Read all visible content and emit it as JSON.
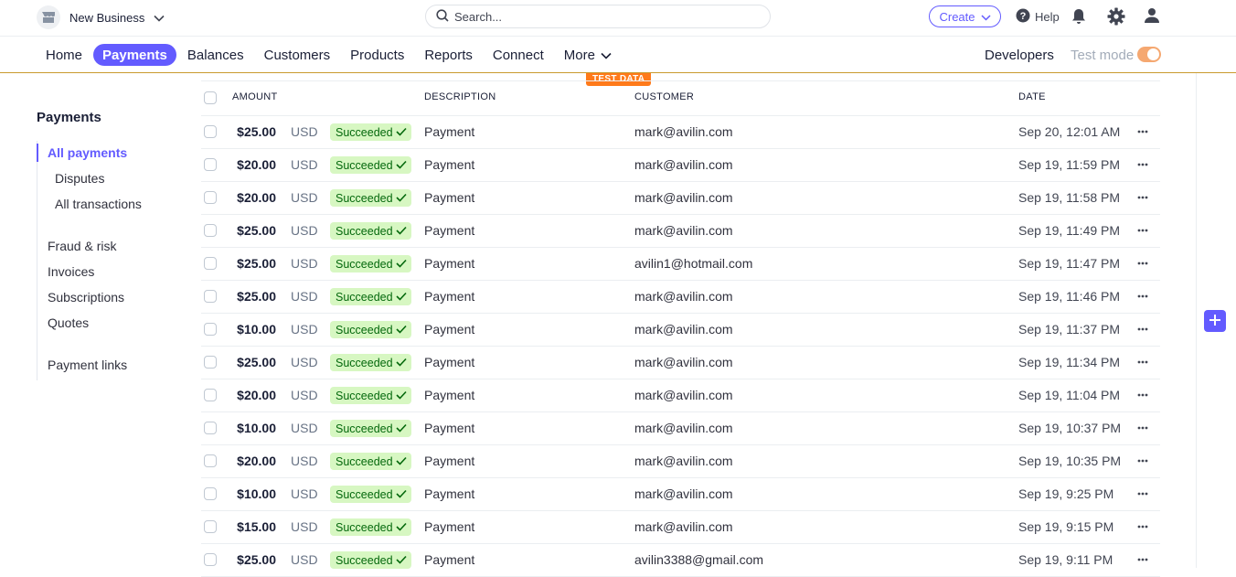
{
  "account": {
    "name": "New Business"
  },
  "search": {
    "placeholder": "Search..."
  },
  "topbar": {
    "create_label": "Create",
    "help_label": "Help"
  },
  "nav": {
    "items": [
      {
        "label": "Home"
      },
      {
        "label": "Payments",
        "active": true
      },
      {
        "label": "Balances"
      },
      {
        "label": "Customers"
      },
      {
        "label": "Products"
      },
      {
        "label": "Reports"
      },
      {
        "label": "Connect"
      },
      {
        "label": "More"
      }
    ],
    "developers_label": "Developers",
    "test_mode_label": "Test mode",
    "test_mode_on": true
  },
  "test_data_badge": "TEST DATA",
  "sidebar": {
    "title": "Payments",
    "links": [
      {
        "label": "All payments",
        "active": true
      },
      {
        "label": "Disputes"
      },
      {
        "label": "All transactions"
      },
      {
        "label": "Fraud & risk"
      },
      {
        "label": "Invoices"
      },
      {
        "label": "Subscriptions"
      },
      {
        "label": "Quotes"
      },
      {
        "label": "Payment links"
      }
    ]
  },
  "table": {
    "headers": {
      "amount": "AMOUNT",
      "description": "DESCRIPTION",
      "customer": "CUSTOMER",
      "date": "DATE"
    },
    "rows": [
      {
        "amount": "$25.00",
        "currency": "USD",
        "status": "Succeeded",
        "description": "Payment",
        "customer": "mark@avilin.com",
        "date": "Sep 20, 12:01 AM"
      },
      {
        "amount": "$20.00",
        "currency": "USD",
        "status": "Succeeded",
        "description": "Payment",
        "customer": "mark@avilin.com",
        "date": "Sep 19, 11:59 PM"
      },
      {
        "amount": "$20.00",
        "currency": "USD",
        "status": "Succeeded",
        "description": "Payment",
        "customer": "mark@avilin.com",
        "date": "Sep 19, 11:58 PM"
      },
      {
        "amount": "$25.00",
        "currency": "USD",
        "status": "Succeeded",
        "description": "Payment",
        "customer": "mark@avilin.com",
        "date": "Sep 19, 11:49 PM"
      },
      {
        "amount": "$25.00",
        "currency": "USD",
        "status": "Succeeded",
        "description": "Payment",
        "customer": "avilin1@hotmail.com",
        "date": "Sep 19, 11:47 PM"
      },
      {
        "amount": "$25.00",
        "currency": "USD",
        "status": "Succeeded",
        "description": "Payment",
        "customer": "mark@avilin.com",
        "date": "Sep 19, 11:46 PM"
      },
      {
        "amount": "$10.00",
        "currency": "USD",
        "status": "Succeeded",
        "description": "Payment",
        "customer": "mark@avilin.com",
        "date": "Sep 19, 11:37 PM"
      },
      {
        "amount": "$25.00",
        "currency": "USD",
        "status": "Succeeded",
        "description": "Payment",
        "customer": "mark@avilin.com",
        "date": "Sep 19, 11:34 PM"
      },
      {
        "amount": "$20.00",
        "currency": "USD",
        "status": "Succeeded",
        "description": "Payment",
        "customer": "mark@avilin.com",
        "date": "Sep 19, 11:04 PM"
      },
      {
        "amount": "$10.00",
        "currency": "USD",
        "status": "Succeeded",
        "description": "Payment",
        "customer": "mark@avilin.com",
        "date": "Sep 19, 10:37 PM"
      },
      {
        "amount": "$20.00",
        "currency": "USD",
        "status": "Succeeded",
        "description": "Payment",
        "customer": "mark@avilin.com",
        "date": "Sep 19, 10:35 PM"
      },
      {
        "amount": "$10.00",
        "currency": "USD",
        "status": "Succeeded",
        "description": "Payment",
        "customer": "mark@avilin.com",
        "date": "Sep 19, 9:25 PM"
      },
      {
        "amount": "$15.00",
        "currency": "USD",
        "status": "Succeeded",
        "description": "Payment",
        "customer": "mark@avilin.com",
        "date": "Sep 19, 9:15 PM"
      },
      {
        "amount": "$25.00",
        "currency": "USD",
        "status": "Succeeded",
        "description": "Payment",
        "customer": "avilin3388@gmail.com",
        "date": "Sep 19, 9:11 PM"
      }
    ]
  },
  "colors": {
    "accent": "#635bff",
    "success_bg": "#d7f7c2",
    "success_text": "#05690d",
    "test_orange": "#ff7a1a"
  },
  "icons": [
    "store-icon",
    "chevron-down-icon",
    "search-icon",
    "help-icon",
    "bell-icon",
    "gear-icon",
    "user-icon",
    "check-icon",
    "more-horizontal-icon",
    "plus-icon"
  ]
}
